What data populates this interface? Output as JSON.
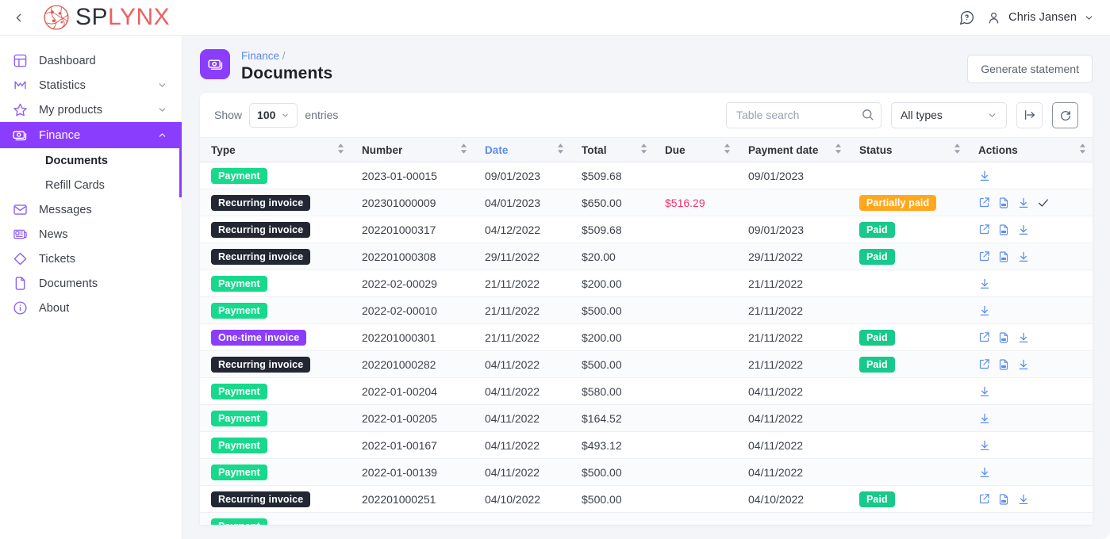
{
  "topbar": {
    "back_icon": "chevron-left-icon",
    "logo_first": "SP",
    "logo_second": "LYNX",
    "help_icon": "help-circle-icon",
    "user_icon": "user-icon",
    "user_name": "Chris Jansen",
    "user_chevron": "chevron-down-icon"
  },
  "sidebar": {
    "items": [
      {
        "label": "Dashboard",
        "icon": "dashboard-icon",
        "chevron": "",
        "active": false
      },
      {
        "label": "Statistics",
        "icon": "chart-icon",
        "chevron": "v",
        "active": false
      },
      {
        "label": "My products",
        "icon": "star-icon",
        "chevron": "v",
        "active": false
      },
      {
        "label": "Finance",
        "icon": "money-icon",
        "chevron": "^",
        "active": true
      },
      {
        "label": "Messages",
        "icon": "envelope-icon",
        "chevron": "",
        "active": false
      },
      {
        "label": "News",
        "icon": "news-icon",
        "chevron": "",
        "active": false
      },
      {
        "label": "Tickets",
        "icon": "ticket-icon",
        "chevron": "",
        "active": false
      },
      {
        "label": "Documents",
        "icon": "file-icon",
        "chevron": "",
        "active": false
      },
      {
        "label": "About",
        "icon": "info-icon",
        "chevron": "",
        "active": false
      }
    ],
    "sub_items": [
      {
        "label": "Documents",
        "current": true
      },
      {
        "label": "Refill Cards",
        "current": false
      }
    ]
  },
  "page": {
    "icon": "money-eye-icon",
    "breadcrumb_parent": "Finance",
    "breadcrumb_sep": "/",
    "title": "Documents",
    "generate_statement_label": "Generate statement"
  },
  "toolbar": {
    "show_label": "Show",
    "entries_value": "100",
    "entries_label": "entries",
    "search_placeholder": "Table search",
    "search_value": "",
    "search_icon": "search-icon",
    "types_value": "All types",
    "export_icon": "export-icon",
    "refresh_icon": "refresh-icon"
  },
  "table": {
    "columns": [
      {
        "label": "Type",
        "sorted": false
      },
      {
        "label": "Number",
        "sorted": false
      },
      {
        "label": "Date",
        "sorted": true
      },
      {
        "label": "Total",
        "sorted": false
      },
      {
        "label": "Due",
        "sorted": false
      },
      {
        "label": "Payment date",
        "sorted": false
      },
      {
        "label": "Status",
        "sorted": false
      },
      {
        "label": "Actions",
        "sorted": false
      }
    ],
    "rows": [
      {
        "type": "Payment",
        "type_class": "b-payment",
        "number": "2023-01-00015",
        "date": "09/01/2023",
        "total": "$509.68",
        "due": "",
        "payment_date": "09/01/2023",
        "status": "",
        "status_class": "",
        "actions": [
          "download"
        ]
      },
      {
        "type": "Recurring invoice",
        "type_class": "b-recurring",
        "number": "202301000009",
        "date": "04/01/2023",
        "total": "$650.00",
        "due": "$516.29",
        "payment_date": "",
        "status": "Partially paid",
        "status_class": "b-partial",
        "actions": [
          "open",
          "pdf",
          "download",
          "check"
        ]
      },
      {
        "type": "Recurring invoice",
        "type_class": "b-recurring",
        "number": "202201000317",
        "date": "04/12/2022",
        "total": "$509.68",
        "due": "",
        "payment_date": "09/01/2023",
        "status": "Paid",
        "status_class": "b-paid",
        "actions": [
          "open",
          "pdf",
          "download"
        ]
      },
      {
        "type": "Recurring invoice",
        "type_class": "b-recurring",
        "number": "202201000308",
        "date": "29/11/2022",
        "total": "$20.00",
        "due": "",
        "payment_date": "29/11/2022",
        "status": "Paid",
        "status_class": "b-paid",
        "actions": [
          "open",
          "pdf",
          "download"
        ]
      },
      {
        "type": "Payment",
        "type_class": "b-payment",
        "number": "2022-02-00029",
        "date": "21/11/2022",
        "total": "$200.00",
        "due": "",
        "payment_date": "21/11/2022",
        "status": "",
        "status_class": "",
        "actions": [
          "download"
        ]
      },
      {
        "type": "Payment",
        "type_class": "b-payment",
        "number": "2022-02-00010",
        "date": "21/11/2022",
        "total": "$500.00",
        "due": "",
        "payment_date": "21/11/2022",
        "status": "",
        "status_class": "",
        "actions": [
          "download"
        ]
      },
      {
        "type": "One-time invoice",
        "type_class": "b-onetime",
        "number": "202201000301",
        "date": "21/11/2022",
        "total": "$200.00",
        "due": "",
        "payment_date": "21/11/2022",
        "status": "Paid",
        "status_class": "b-paid",
        "actions": [
          "open",
          "pdf",
          "download"
        ]
      },
      {
        "type": "Recurring invoice",
        "type_class": "b-recurring",
        "number": "202201000282",
        "date": "04/11/2022",
        "total": "$500.00",
        "due": "",
        "payment_date": "21/11/2022",
        "status": "Paid",
        "status_class": "b-paid",
        "actions": [
          "open",
          "pdf",
          "download"
        ]
      },
      {
        "type": "Payment",
        "type_class": "b-payment",
        "number": "2022-01-00204",
        "date": "04/11/2022",
        "total": "$580.00",
        "due": "",
        "payment_date": "04/11/2022",
        "status": "",
        "status_class": "",
        "actions": [
          "download"
        ]
      },
      {
        "type": "Payment",
        "type_class": "b-payment",
        "number": "2022-01-00205",
        "date": "04/11/2022",
        "total": "$164.52",
        "due": "",
        "payment_date": "04/11/2022",
        "status": "",
        "status_class": "",
        "actions": [
          "download"
        ]
      },
      {
        "type": "Payment",
        "type_class": "b-payment",
        "number": "2022-01-00167",
        "date": "04/11/2022",
        "total": "$493.12",
        "due": "",
        "payment_date": "04/11/2022",
        "status": "",
        "status_class": "",
        "actions": [
          "download"
        ]
      },
      {
        "type": "Payment",
        "type_class": "b-payment",
        "number": "2022-01-00139",
        "date": "04/11/2022",
        "total": "$500.00",
        "due": "",
        "payment_date": "04/11/2022",
        "status": "",
        "status_class": "",
        "actions": [
          "download"
        ]
      },
      {
        "type": "Recurring invoice",
        "type_class": "b-recurring",
        "number": "202201000251",
        "date": "04/10/2022",
        "total": "$500.00",
        "due": "",
        "payment_date": "04/10/2022",
        "status": "Paid",
        "status_class": "b-paid",
        "actions": [
          "open",
          "pdf",
          "download"
        ]
      },
      {
        "type": "Payment",
        "type_class": "b-payment",
        "number": "",
        "date": "",
        "total": "",
        "due": "",
        "payment_date": "",
        "status": "",
        "status_class": "",
        "actions": []
      }
    ]
  },
  "colors": {
    "accent_purple": "#8b3dfd",
    "link_blue": "#5b8def",
    "green": "#17d98c",
    "orange": "#ffa81f",
    "pink": "#f8336d",
    "dark": "#222733"
  }
}
